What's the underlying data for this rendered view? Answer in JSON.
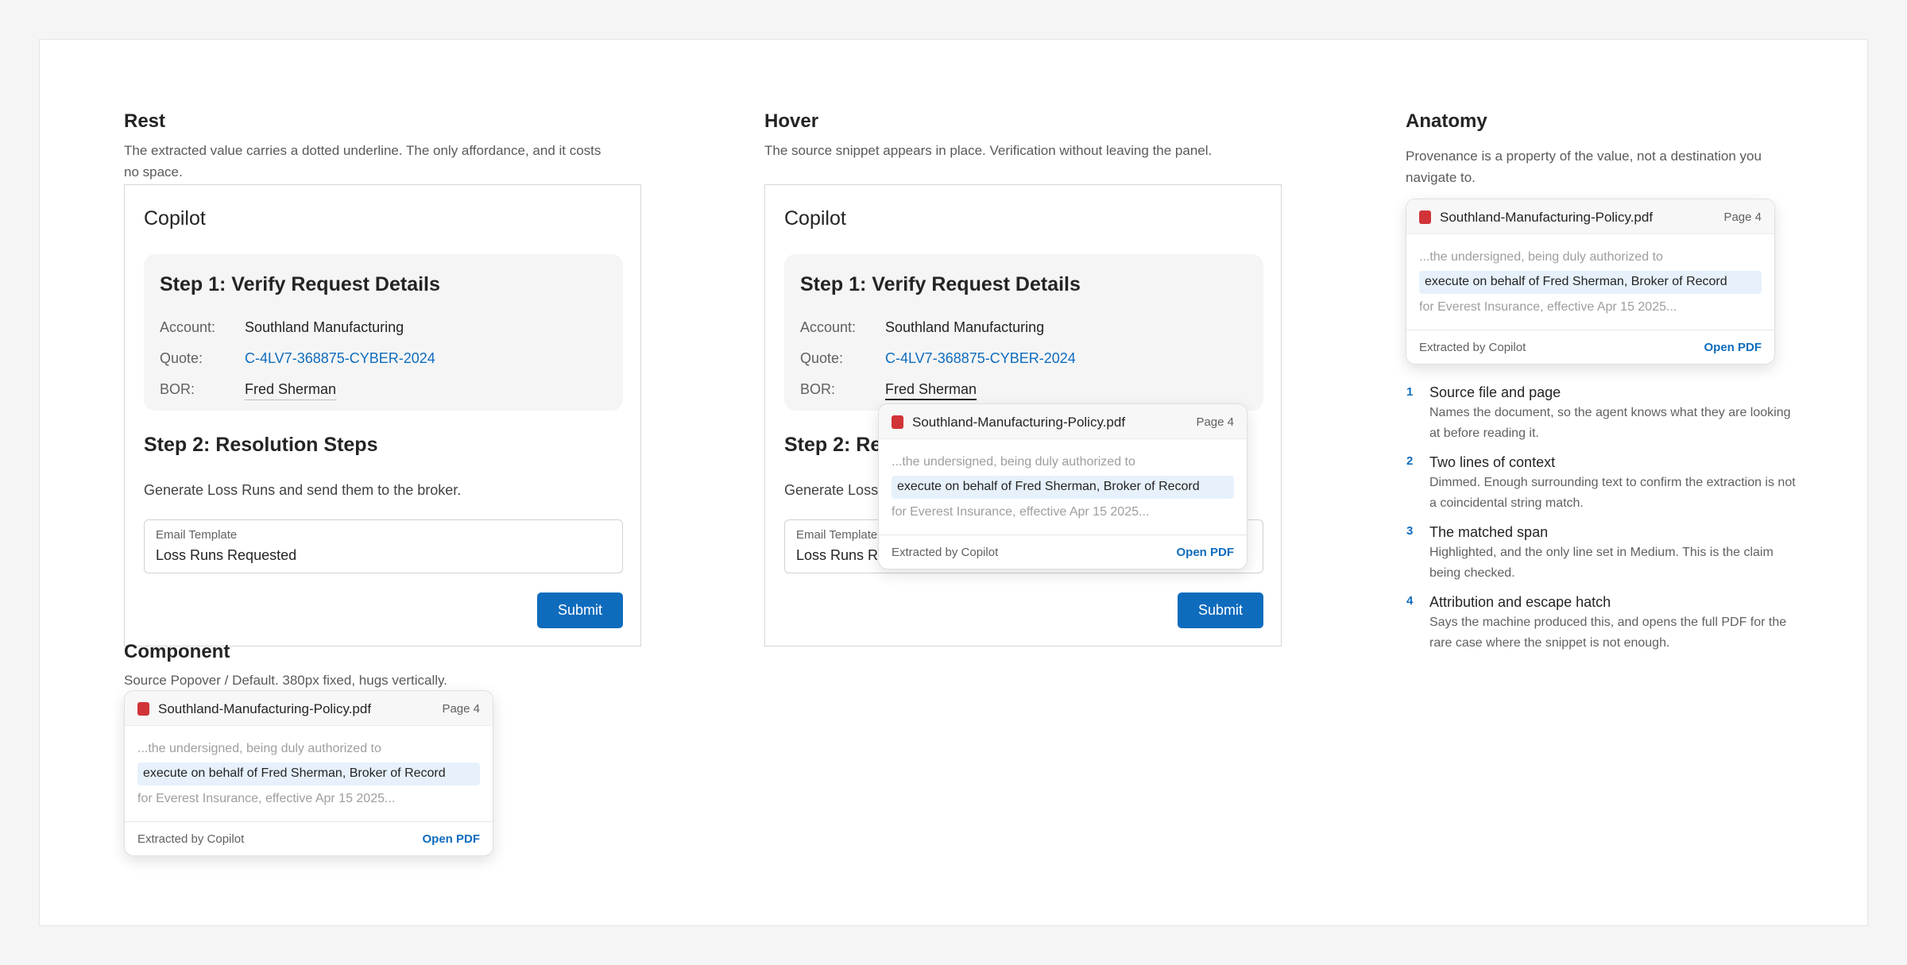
{
  "copilot": {
    "title": "Copilot",
    "step1_title": "Step 1: Verify Request Details",
    "rows": [
      {
        "label": "Account:",
        "value": "Southland Manufacturing"
      },
      {
        "label": "Quote:",
        "value": "C-4LV7-368875-CYBER-2024"
      },
      {
        "label": "BOR:",
        "value": "Fred Sherman"
      }
    ],
    "step2_title": "Step 2: Resolution Steps",
    "step2_title_clipped": "Step 2: Re",
    "step2_desc": "Generate Loss Runs and send them to the broker.",
    "step2_desc_clipped": "Generate Loss",
    "email_label": "Email Template",
    "email_label_clipped": "Email Template",
    "email_value": "Loss Runs Requested",
    "email_value_clipped": "Loss Runs Re",
    "submit_label": "Submit"
  },
  "popover": {
    "file_name": "Southland-Manufacturing-Policy.pdf",
    "page": "Page 4",
    "context_before": "...the undersigned, being duly authorized to",
    "match": "execute on behalf of Fred Sherman, Broker of Record",
    "context_after": "for Everest Insurance, effective Apr 15 2025...",
    "attribution": "Extracted by Copilot",
    "open_label": "Open PDF",
    "file_icon": "pdf-file-icon",
    "file_icon_color": "#d13438"
  },
  "sections": {
    "rest": {
      "title": "Rest",
      "desc_line1": "The extracted value carries a dotted underline. The only affordance, and it costs",
      "desc_line2": "no space."
    },
    "hover": {
      "title": "Hover",
      "desc": "The source snippet appears in place. Verification without leaving the panel."
    },
    "anatomy": {
      "title": "Anatomy",
      "desc_line1": "Provenance is a property of the value, not a destination you",
      "desc_line2": "navigate to.",
      "items": [
        {
          "num": "1",
          "title": "Source file and page",
          "desc_line1": "Names the document, so the agent knows what they are looking",
          "desc_line2": "at before reading it."
        },
        {
          "num": "2",
          "title": "Two lines of context",
          "desc_line1": "Dimmed. Enough surrounding text to confirm the extraction is not",
          "desc_line2": "a coincidental string match."
        },
        {
          "num": "3",
          "title": "The matched span",
          "desc_line1": "Highlighted, and the only line set in Medium. This is the claim",
          "desc_line2": "being checked."
        },
        {
          "num": "4",
          "title": "Attribution and escape hatch",
          "desc_line1": "Says the machine produced this, and opens the full PDF for the",
          "desc_line2": "rare case where the snippet is not enough."
        }
      ]
    },
    "component": {
      "title": "Component",
      "desc": "Source Popover / Default. 380px fixed, hugs vertically."
    }
  },
  "colors": {
    "accent": "#0f6cbd",
    "highlight": "#e6f1fb",
    "pdf_red": "#d13438"
  }
}
